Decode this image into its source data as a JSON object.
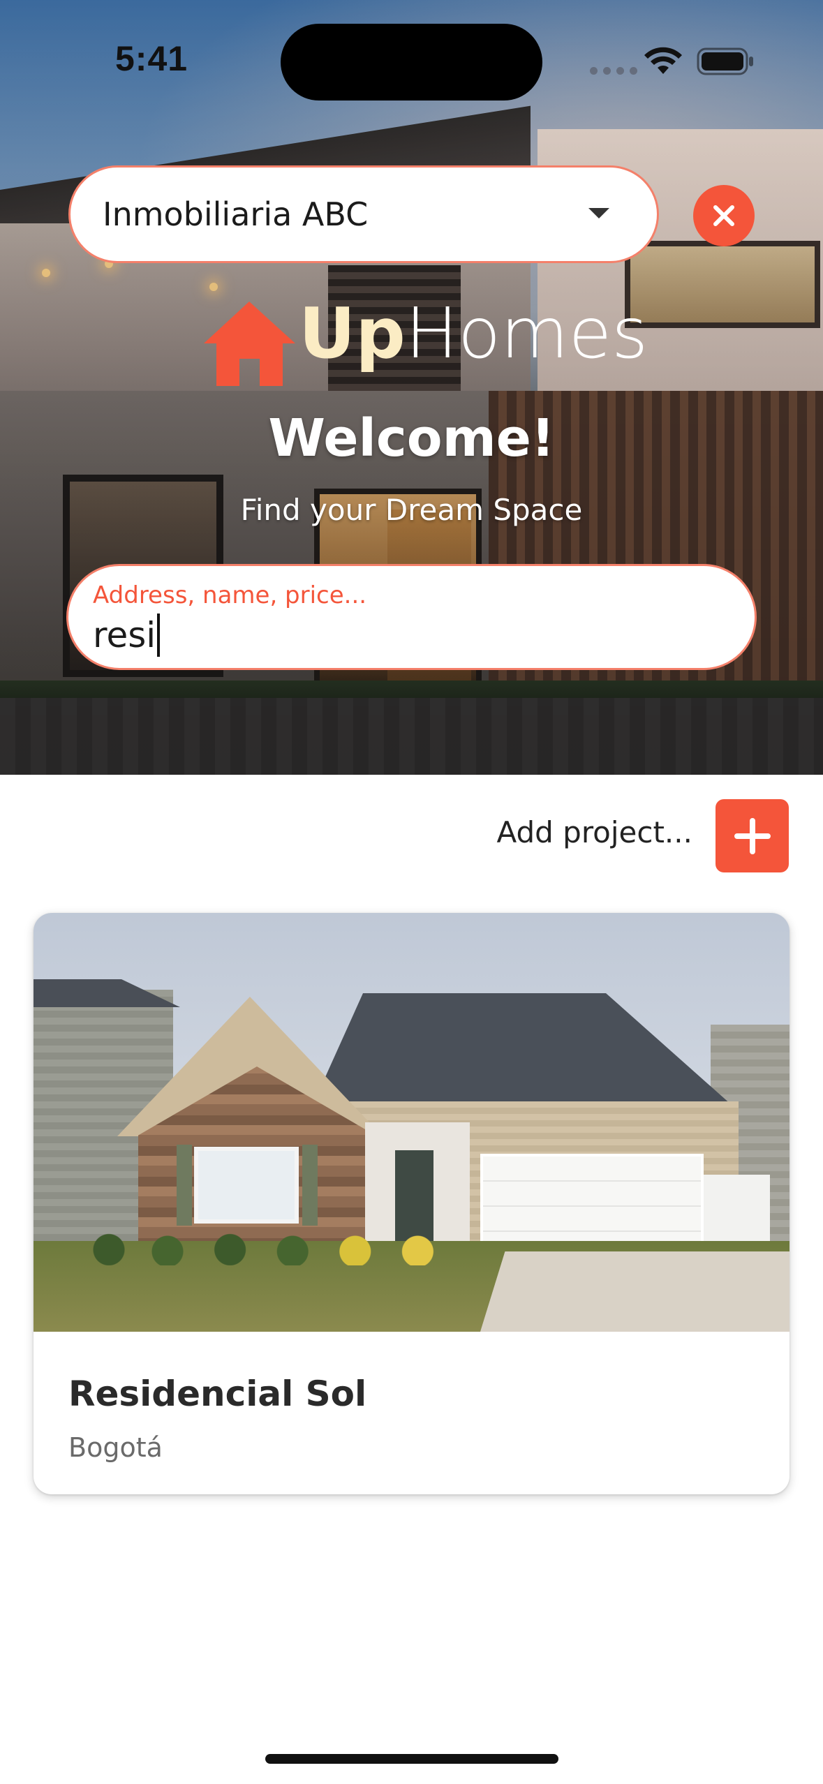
{
  "status_bar": {
    "time": "5:41"
  },
  "company_select": {
    "selected": "Inmobiliaria ABC"
  },
  "brand": {
    "logo_up": "Up",
    "logo_homes": "Homes",
    "accent_color": "#f4553a"
  },
  "hero": {
    "title": "Welcome!",
    "subtitle": "Find your Dream Space"
  },
  "search": {
    "label": "Address, name, price...",
    "value": "resi"
  },
  "actions": {
    "add_project_label": "Add project..."
  },
  "projects": [
    {
      "name": "Residencial Sol",
      "city": "Bogotá"
    }
  ]
}
